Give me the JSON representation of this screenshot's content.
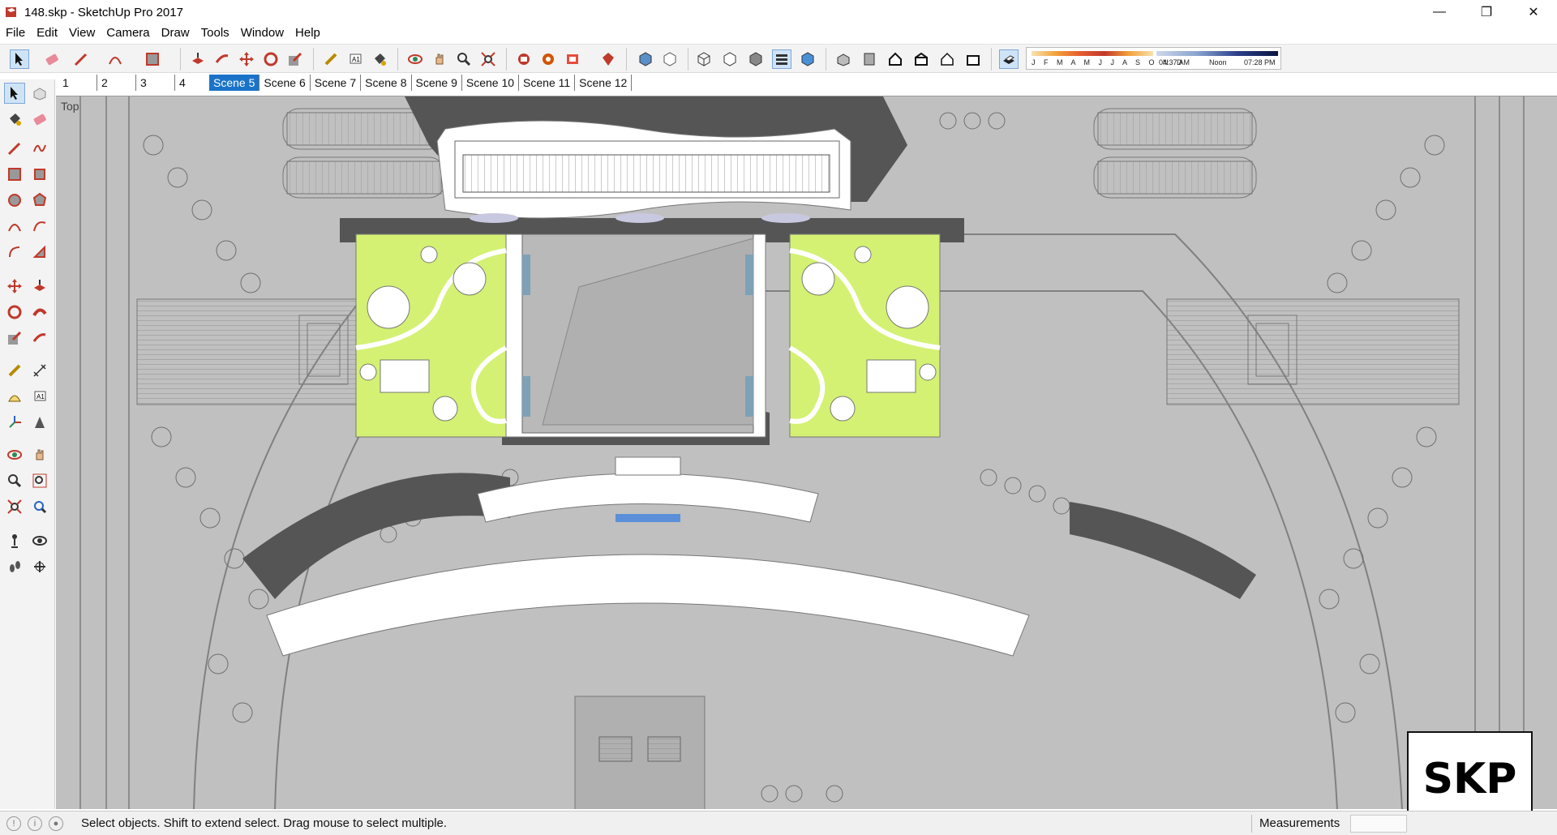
{
  "window": {
    "title": "148.skp - SketchUp Pro 2017",
    "minimize": "—",
    "maximize": "❐",
    "close": "✕"
  },
  "menu": [
    "File",
    "Edit",
    "View",
    "Camera",
    "Draw",
    "Tools",
    "Window",
    "Help"
  ],
  "shadow_panel": {
    "months": "J F M A M J J A S O N D",
    "time_start": "04:37 AM",
    "time_mid": "Noon",
    "time_end": "07:28 PM"
  },
  "scenes": [
    "1",
    "2",
    "3",
    "4",
    "Scene 5",
    "Scene 6",
    "Scene 7",
    "Scene 8",
    "Scene 9",
    "Scene 10",
    "Scene 11",
    "Scene 12"
  ],
  "active_scene": "Scene 5",
  "viewport": {
    "view_label": "Top",
    "logo_text": "SKP"
  },
  "status": {
    "message": "Select objects. Shift to extend select. Drag mouse to select multiple.",
    "measurements_label": "Measurements",
    "measurements_value": ""
  },
  "colors": {
    "ground": "#c0c0c0",
    "shadow": "#555555",
    "lawn": "#d4f173",
    "selection": "#1a73c8"
  }
}
